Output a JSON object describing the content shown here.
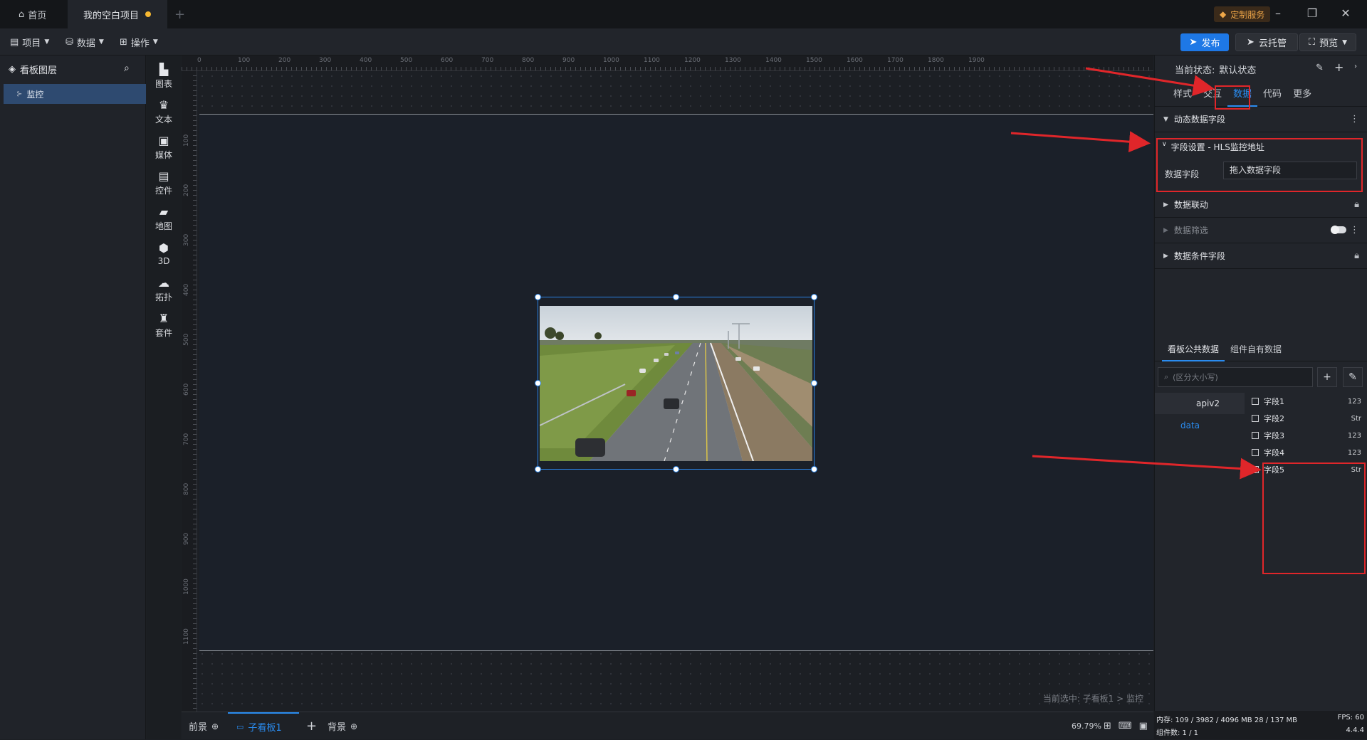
{
  "titlebar": {
    "tabs": [
      {
        "label": "首页"
      },
      {
        "label": "我的空白项目"
      }
    ],
    "custom_service": "定制服务"
  },
  "toolbar": {
    "menus": [
      "项目",
      "数据",
      "操作"
    ],
    "publish": "发布",
    "cloud": "云托管",
    "preview": "预览"
  },
  "layers": {
    "title": "看板图层",
    "items": [
      {
        "label": "监控"
      }
    ]
  },
  "components": [
    {
      "label": "图表",
      "icon": "bar-chart-icon"
    },
    {
      "label": "文本",
      "icon": "crown-text-icon"
    },
    {
      "label": "媒体",
      "icon": "media-bag-icon"
    },
    {
      "label": "控件",
      "icon": "widget-icon"
    },
    {
      "label": "地图",
      "icon": "map-icon"
    },
    {
      "label": "3D",
      "icon": "cube-icon"
    },
    {
      "label": "拓扑",
      "icon": "topology-icon"
    },
    {
      "label": "套件",
      "icon": "suite-shirt-icon"
    }
  ],
  "ruler": {
    "top": [
      "0",
      "100",
      "200",
      "300",
      "400",
      "500",
      "600",
      "700",
      "800",
      "900",
      "1000",
      "1100",
      "1200",
      "1300",
      "1400",
      "1500",
      "1600",
      "1700",
      "1800",
      "1900"
    ],
    "left": [
      "100",
      "200",
      "300",
      "400",
      "500",
      "600",
      "700",
      "800",
      "900",
      "1000",
      "1100"
    ]
  },
  "canvas": {
    "current_selection": "当前选中: 子看板1 > 监控"
  },
  "bottombar": {
    "foreground": "前景",
    "subboard": "子看板1",
    "background": "背景",
    "zoom": "69.79%"
  },
  "right_panel": {
    "status_label": "当前状态:",
    "status_value": "默认状态",
    "tabs": [
      "样式",
      "交互",
      "数据",
      "代码",
      "更多"
    ],
    "active_tab": "数据",
    "sections": {
      "dynamic_fields": "动态数据字段",
      "field_setting": "字段设置 - HLS监控地址",
      "data_field_label": "数据字段",
      "data_field_placeholder": "拖入数据字段",
      "data_linkage": "数据联动",
      "data_filter": "数据筛选",
      "condition_fields": "数据条件字段"
    },
    "data_tabs": [
      "看板公共数据",
      "组件自有数据"
    ],
    "search_placeholder": "(区分大小写)",
    "api_name": "apiv2",
    "data_node": "data",
    "fields": [
      {
        "name": "字段1",
        "type": "123"
      },
      {
        "name": "字段2",
        "type": "Str"
      },
      {
        "name": "字段3",
        "type": "123"
      },
      {
        "name": "字段4",
        "type": "123"
      },
      {
        "name": "字段5",
        "type": "Str"
      }
    ]
  },
  "stats": {
    "memory": "内存: 109 / 3982 / 4096 MB  28 / 137 MB",
    "fps": "FPS: 60",
    "count": "组件数: 1 / 1",
    "version": "4.4.4"
  },
  "colors": {
    "accent": "#1e78e6",
    "annotation": "#e0262a",
    "selection": "#2a82e4"
  }
}
